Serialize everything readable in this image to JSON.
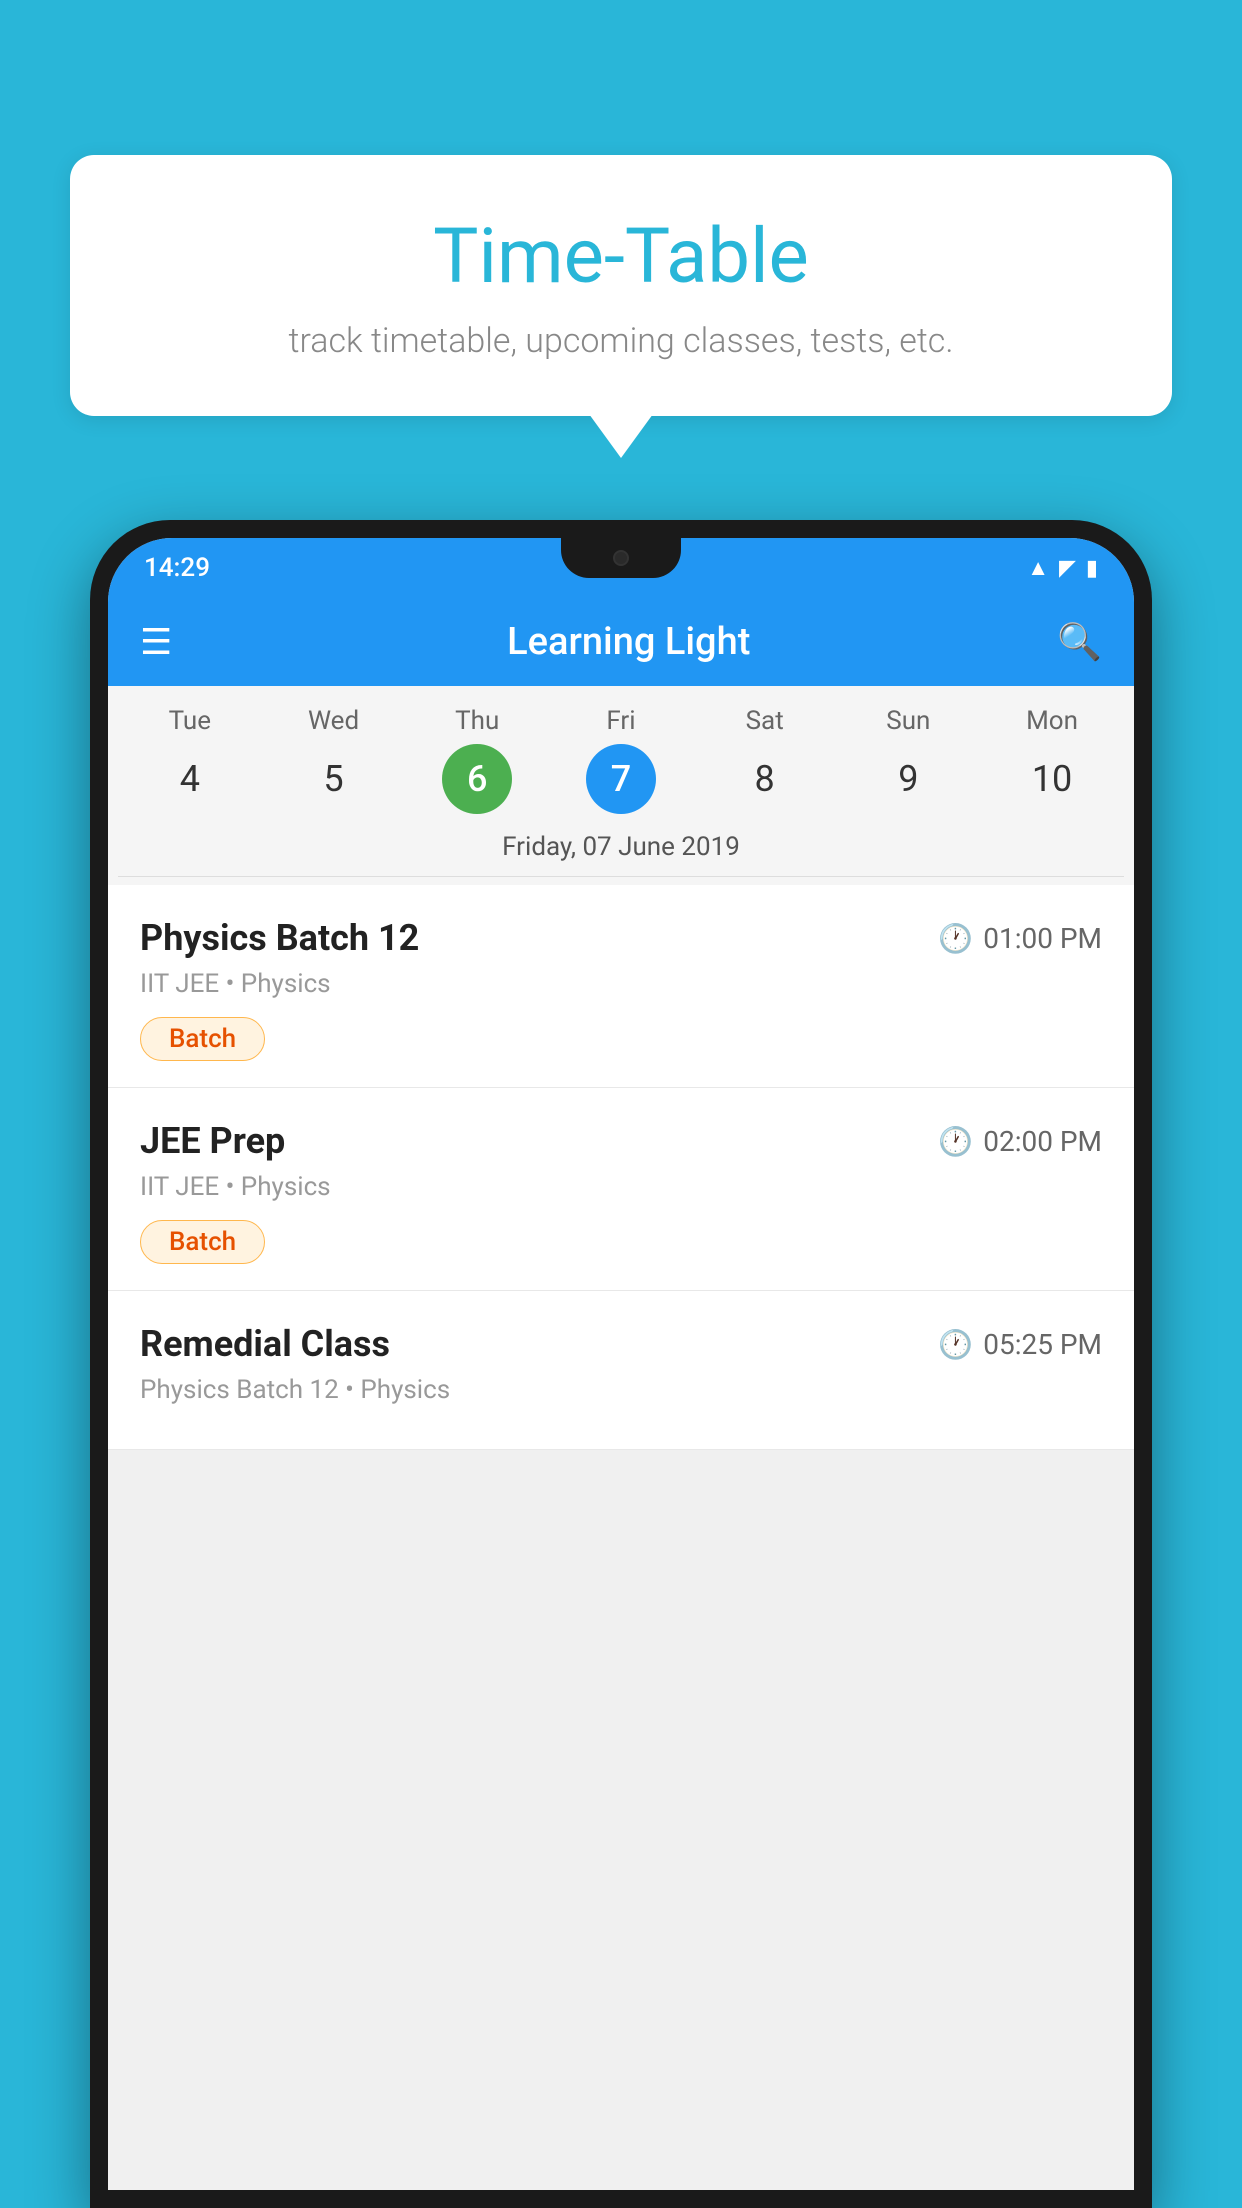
{
  "background_color": "#29B6D8",
  "speech_bubble": {
    "title": "Time-Table",
    "subtitle": "track timetable, upcoming classes, tests, etc."
  },
  "phone": {
    "status_bar": {
      "time": "14:29",
      "icons": [
        "wifi",
        "signal",
        "battery"
      ]
    },
    "app_bar": {
      "title": "Learning Light"
    },
    "calendar": {
      "days": [
        {
          "name": "Tue",
          "num": "4",
          "state": "normal"
        },
        {
          "name": "Wed",
          "num": "5",
          "state": "normal"
        },
        {
          "name": "Thu",
          "num": "6",
          "state": "today"
        },
        {
          "name": "Fri",
          "num": "7",
          "state": "selected"
        },
        {
          "name": "Sat",
          "num": "8",
          "state": "normal"
        },
        {
          "name": "Sun",
          "num": "9",
          "state": "normal"
        },
        {
          "name": "Mon",
          "num": "10",
          "state": "normal"
        }
      ],
      "selected_date_label": "Friday, 07 June 2019"
    },
    "schedule": {
      "items": [
        {
          "title": "Physics Batch 12",
          "time": "01:00 PM",
          "subtitle": "IIT JEE • Physics",
          "badge": "Batch"
        },
        {
          "title": "JEE Prep",
          "time": "02:00 PM",
          "subtitle": "IIT JEE • Physics",
          "badge": "Batch"
        },
        {
          "title": "Remedial Class",
          "time": "05:25 PM",
          "subtitle": "Physics Batch 12 • Physics",
          "badge": null
        }
      ]
    }
  }
}
